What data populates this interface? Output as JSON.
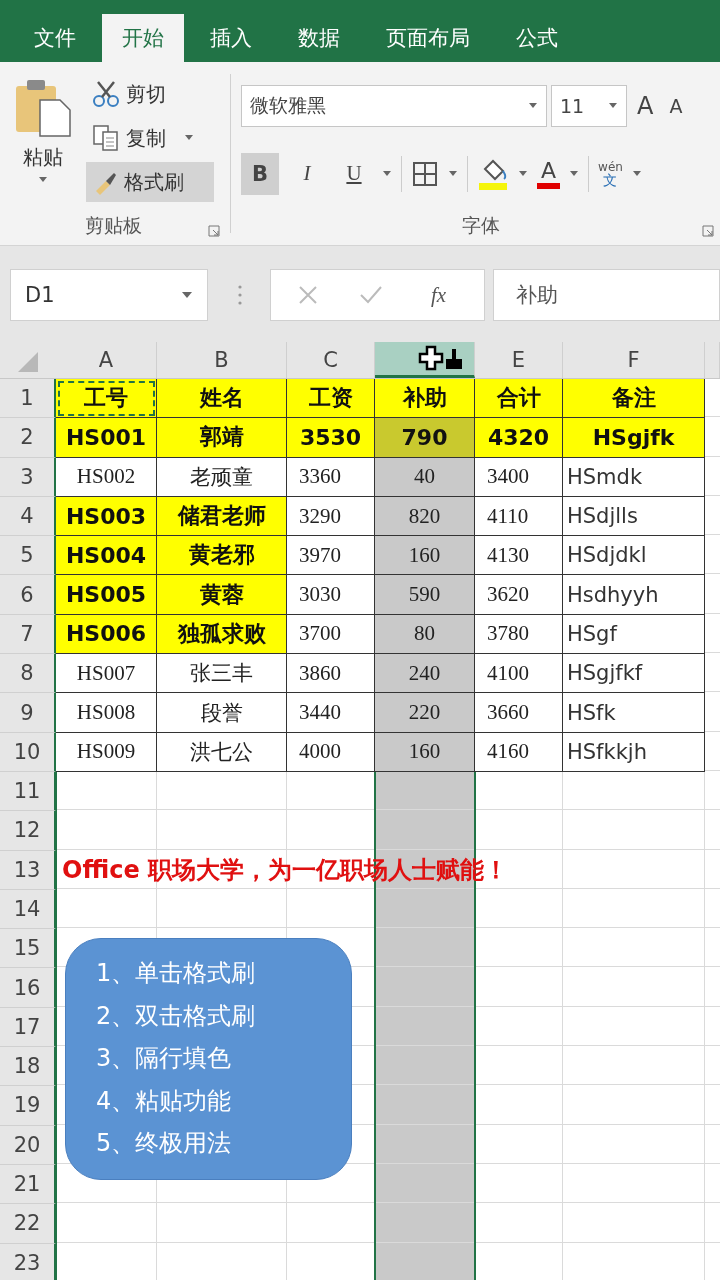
{
  "ribbon_tabs": [
    {
      "label": "文件",
      "selected": false
    },
    {
      "label": "开始",
      "selected": true
    },
    {
      "label": "插入",
      "selected": false
    },
    {
      "label": "数据",
      "selected": false
    },
    {
      "label": "页面布局",
      "selected": false
    },
    {
      "label": "公式",
      "selected": false
    }
  ],
  "clipboard": {
    "paste": "粘贴",
    "cut": "剪切",
    "copy": "复制",
    "format_painter": {
      "label": "格式刷",
      "on": true
    },
    "group_label": "剪贴板"
  },
  "font": {
    "family": "微软雅黑",
    "size": "11",
    "grow": "A",
    "shrink": "A",
    "styles": [
      {
        "label": "B",
        "selected": true
      },
      {
        "label": "I",
        "selected": false
      },
      {
        "label": "U",
        "selected": false
      }
    ],
    "font_color": "A",
    "phonetic_top": "wén",
    "phonetic_bottom": "文",
    "group_label": "字体"
  },
  "formula_bar": {
    "name_box": "D1",
    "fx": "fx",
    "value": "补助"
  },
  "columns": [
    {
      "label": "A",
      "selected": false
    },
    {
      "label": "B",
      "selected": false
    },
    {
      "label": "C",
      "selected": false
    },
    {
      "selected": true
    },
    {
      "label": "E",
      "selected": false
    },
    {
      "label": "F",
      "selected": false
    }
  ],
  "rows": [
    {
      "number": "1",
      "cells": [
        {
          "text": "工号",
          "kind": "highlight",
          "marquee": true
        },
        {
          "text": "姓名",
          "kind": "highlight"
        },
        {
          "text": "工资",
          "kind": "highlight"
        },
        {
          "text": "补助",
          "kind": "highlight"
        },
        {
          "text": "合计",
          "kind": "highlight"
        },
        {
          "text": "备注",
          "kind": "highlight"
        }
      ]
    },
    {
      "number": "2",
      "cells": [
        {
          "text": "HS001",
          "kind": "highlight"
        },
        {
          "text": "郭靖",
          "kind": "highlight"
        },
        {
          "text": "3530",
          "kind": "highlight"
        },
        {
          "text": "790",
          "kind": "highlight"
        },
        {
          "text": "4320",
          "kind": "highlight"
        },
        {
          "text": "HSgjfk",
          "kind": "highlight"
        }
      ]
    },
    {
      "number": "3",
      "cells": [
        {
          "text": "HS002",
          "kind": "serif"
        },
        {
          "text": "老顽童",
          "kind": "serif"
        },
        {
          "text": "3360",
          "kind": "serif"
        },
        {
          "text": "40",
          "kind": "serif"
        },
        {
          "text": "3400",
          "kind": "serif"
        },
        {
          "text": "HSmdk",
          "kind": "sans"
        }
      ]
    },
    {
      "number": "4",
      "cells": [
        {
          "text": "HS003",
          "kind": "highlight"
        },
        {
          "text": "储君老师",
          "kind": "highlight"
        },
        {
          "text": "3290",
          "kind": "serif"
        },
        {
          "text": "820",
          "kind": "serif"
        },
        {
          "text": "4110",
          "kind": "serif"
        },
        {
          "text": "HSdjlls",
          "kind": "sans"
        }
      ]
    },
    {
      "number": "5",
      "cells": [
        {
          "text": "HS004",
          "kind": "highlight"
        },
        {
          "text": "黄老邪",
          "kind": "highlight"
        },
        {
          "text": "3970",
          "kind": "serif"
        },
        {
          "text": "160",
          "kind": "serif"
        },
        {
          "text": "4130",
          "kind": "serif"
        },
        {
          "text": "HSdjdkl",
          "kind": "sans"
        }
      ]
    },
    {
      "number": "6",
      "cells": [
        {
          "text": "HS005",
          "kind": "highlight"
        },
        {
          "text": "黄蓉",
          "kind": "highlight"
        },
        {
          "text": "3030",
          "kind": "serif"
        },
        {
          "text": "590",
          "kind": "serif"
        },
        {
          "text": "3620",
          "kind": "serif"
        },
        {
          "text": "Hsdhyyh",
          "kind": "sans"
        }
      ]
    },
    {
      "number": "7",
      "cells": [
        {
          "text": "HS006",
          "kind": "highlight"
        },
        {
          "text": "独孤求败",
          "kind": "highlight"
        },
        {
          "text": "3700",
          "kind": "serif"
        },
        {
          "text": "80",
          "kind": "serif"
        },
        {
          "text": "3780",
          "kind": "serif"
        },
        {
          "text": "HSgf",
          "kind": "sans"
        }
      ]
    },
    {
      "number": "8",
      "cells": [
        {
          "text": "HS007",
          "kind": "serif"
        },
        {
          "text": "张三丰",
          "kind": "serif"
        },
        {
          "text": "3860",
          "kind": "serif"
        },
        {
          "text": "240",
          "kind": "serif"
        },
        {
          "text": "4100",
          "kind": "serif"
        },
        {
          "text": "HSgjfkf",
          "kind": "sans"
        }
      ]
    },
    {
      "number": "9",
      "cells": [
        {
          "text": "HS008",
          "kind": "serif"
        },
        {
          "text": "段誉",
          "kind": "serif"
        },
        {
          "text": "3440",
          "kind": "serif"
        },
        {
          "text": "220",
          "kind": "serif"
        },
        {
          "text": "3660",
          "kind": "serif"
        },
        {
          "text": "HSfk",
          "kind": "sans"
        }
      ]
    },
    {
      "number": "10",
      "cells": [
        {
          "text": "HS009",
          "kind": "serif"
        },
        {
          "text": "洪七公",
          "kind": "serif"
        },
        {
          "text": "4000",
          "kind": "serif"
        },
        {
          "text": "160",
          "kind": "serif"
        },
        {
          "text": "4160",
          "kind": "serif"
        },
        {
          "text": "HSfkkjh",
          "kind": "sans"
        }
      ]
    },
    {
      "number": "11"
    },
    {
      "number": "12"
    },
    {
      "number": "13",
      "note": "Office 职场大学，为一亿职场人士赋能！"
    },
    {
      "number": "14"
    },
    {
      "number": "15"
    },
    {
      "number": "16"
    },
    {
      "number": "17"
    },
    {
      "number": "18"
    },
    {
      "number": "19"
    },
    {
      "number": "20"
    },
    {
      "number": "21"
    },
    {
      "number": "22"
    },
    {
      "number": "23"
    }
  ],
  "callout": {
    "items": [
      "1、单击格式刷",
      "2、双击格式刷",
      "3、隔行填色",
      "4、粘贴功能",
      "5、终极用法"
    ]
  }
}
